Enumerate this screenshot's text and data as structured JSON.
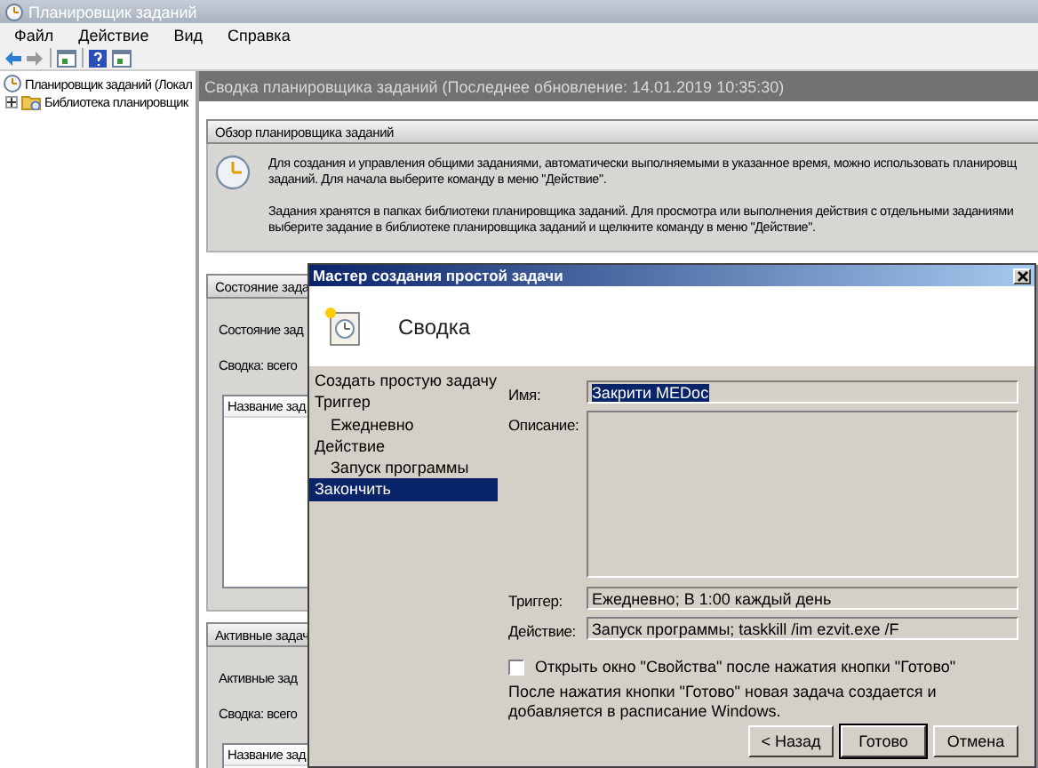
{
  "window": {
    "title": "Планировщик заданий"
  },
  "menu": [
    "Файл",
    "Действие",
    "Вид",
    "Справка"
  ],
  "tree": [
    {
      "label": "Планировщик заданий (Локал",
      "children": [
        {
          "label": "Библиотека планировщик",
          "expanded": false
        }
      ]
    }
  ],
  "summary_header": "Сводка планировщика заданий (Последнее обновление: 14.01.2019 10:35:30)",
  "sections": [
    {
      "kind": "overview",
      "title": "Обзор планировщика заданий",
      "paragraphs": [
        [
          "Для создания и управления общими заданиями, автоматически выполняемыми в указанное время, можно использовать планировщ",
          "заданий. Для начала выберите команду в меню \"Действие\"."
        ],
        [
          "Задания хранятся в папках библиотеки планировщика заданий. Для просмотра или выполнения действия с отдельными заданиями",
          "выберите задание в библиотеке планировщика заданий и щелкните команду в меню \"Действие\"."
        ]
      ]
    },
    {
      "kind": "status",
      "title": "Состояние зада",
      "lines": [
        "Состояние зад",
        "Сводка: всего"
      ],
      "columns": [
        "Название зад"
      ]
    },
    {
      "kind": "status",
      "title": "Активные задач",
      "lines": [
        "Активные зад",
        "Сводка: всего"
      ],
      "columns": [
        "Название зад"
      ]
    }
  ],
  "dialog": {
    "title": "Мастер создания простой задачи",
    "heading": "Сводка",
    "steps": [
      {
        "label": "Создать простую задачу",
        "selected": false
      },
      {
        "label": "Триггер",
        "selected": false,
        "children": [
          {
            "label": "Ежедневно",
            "selected": false
          }
        ]
      },
      {
        "label": "Действие",
        "selected": false,
        "children": [
          {
            "label": "Запуск программы",
            "selected": false
          }
        ]
      },
      {
        "label": "Закончить",
        "selected": true
      }
    ],
    "fields": [
      {
        "kind": "line",
        "label": "Имя:",
        "value": "Закрити MEDoc",
        "text_selected": true
      },
      {
        "kind": "area",
        "label": "Описание:"
      },
      {
        "kind": "line",
        "label": "Триггер:",
        "value": "Ежедневно; В 1:00 каждый день",
        "text_selected": false
      },
      {
        "kind": "line",
        "label": "Действие:",
        "value": "Запуск программы; taskkill /im ezvit.exe /F",
        "text_selected": false
      }
    ],
    "checkbox": {
      "label": "Открыть окно \"Свойства\" после нажатия кнопки \"Готово\"",
      "checked": false
    },
    "note": "После нажатия кнопки \"Готово\" новая задача создается и добавляется в расписание Windows.",
    "buttons": [
      {
        "label": "< Назад",
        "default": false
      },
      {
        "label": "Готово",
        "default": true
      },
      {
        "label": "Отмена",
        "default": false
      }
    ]
  }
}
